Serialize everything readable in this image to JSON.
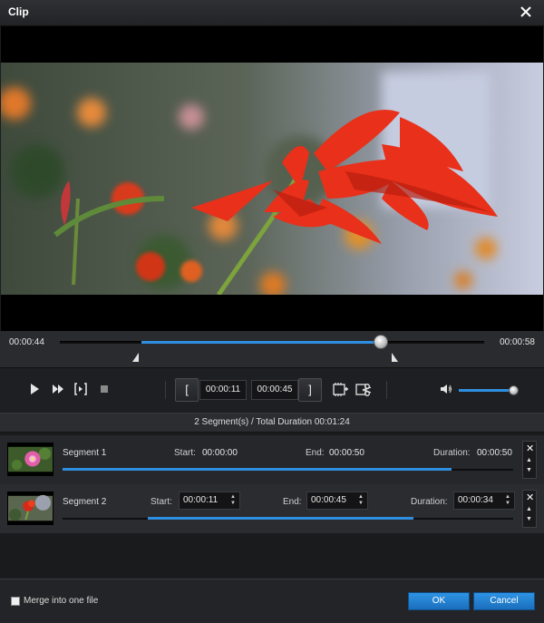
{
  "window": {
    "title": "Clip",
    "close_icon": "close-icon"
  },
  "player": {
    "current_time": "00:00:44",
    "total_time": "00:00:58",
    "trim_start": "00:00:11",
    "trim_end": "00:00:45",
    "start_bracket": "[",
    "end_bracket": "]",
    "volume": 0.9,
    "accent_color": "#2e8fe0"
  },
  "summary": {
    "text": "2 Segment(s) / Total Duration 00:01:24"
  },
  "segments": [
    {
      "name": "Segment 1",
      "start_label": "Start:",
      "start": "00:00:00",
      "end_label": "End:",
      "end": "00:00:50",
      "duration_label": "Duration:",
      "duration": "00:00:50"
    },
    {
      "name": "Segment 2",
      "start_label": "Start:",
      "start": "00:00:11",
      "end_label": "End:",
      "end": "00:00:45",
      "duration_label": "Duration:",
      "duration": "00:00:34"
    }
  ],
  "footer": {
    "merge_label": "Merge into one file",
    "merge_checked": false,
    "ok_label": "OK",
    "cancel_label": "Cancel"
  }
}
